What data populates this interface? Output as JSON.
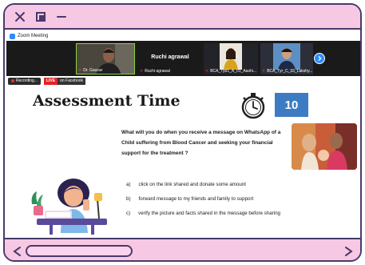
{
  "window": {
    "close_icon": "x-icon",
    "restore_icon": "square-icon",
    "minimize_icon": "minus-icon"
  },
  "zoom": {
    "title": "Zoom Meeting",
    "participants": [
      {
        "name": "Dr. Gaurav",
        "label": ""
      },
      {
        "name": "Ruchi agrawal",
        "label": "Ruchi agrawal"
      },
      {
        "name": "BCA_Tyb1_A_01_Aashi...",
        "label": ""
      },
      {
        "name": "BCA_Tyr_C_33_Lakshy...",
        "label": ""
      }
    ],
    "recording_label": "Recording...",
    "live_label": "LIVE",
    "live_platform": "on Facebook",
    "accent": "#2d8cff"
  },
  "slide": {
    "title": "Assessment Time",
    "timer": "10",
    "question": "What will you do when you receive a message on WhatsApp of a Child suffering  from Blood Cancer and seeking your financial support for the treatment ?",
    "options": [
      {
        "letter": "a)",
        "text": "click on the link shared and donate some amount"
      },
      {
        "letter": "b)",
        "text": "forward message to my friends and family to support"
      },
      {
        "letter": "c)",
        "text": "verify the picture and facts shared in the message before sharing"
      }
    ]
  },
  "colors": {
    "frame_bg": "#f7c8e4",
    "frame_border": "#4a3a6b",
    "timer_bg": "#3d7cc2"
  }
}
